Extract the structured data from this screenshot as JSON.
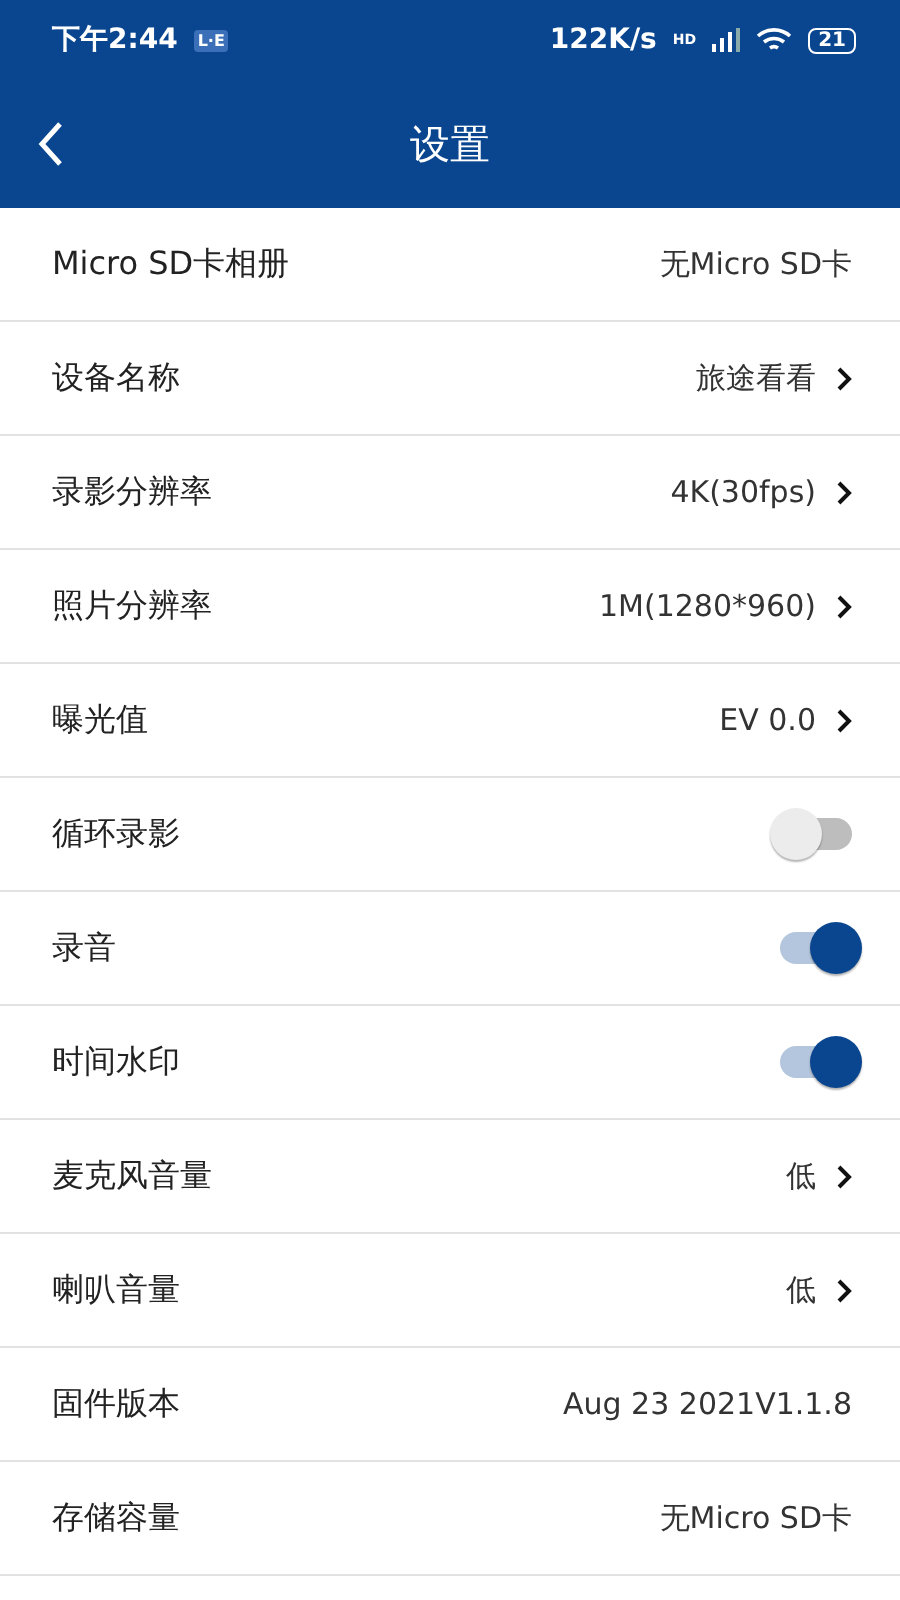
{
  "status_bar": {
    "time": "下午2:44",
    "badge": "L·E",
    "speed": "122K/s",
    "network": "HD",
    "battery": "21"
  },
  "header": {
    "title": "设置"
  },
  "rows": [
    {
      "kind": "value",
      "label": "Micro SD卡相册",
      "value": "无Micro SD卡"
    },
    {
      "kind": "link",
      "label": "设备名称",
      "value": "旅途看看"
    },
    {
      "kind": "link",
      "label": "录影分辨率",
      "value": "4K(30fps)"
    },
    {
      "kind": "link",
      "label": "照片分辨率",
      "value": "1M(1280*960)"
    },
    {
      "kind": "link",
      "label": "曝光值",
      "value": "EV 0.0"
    },
    {
      "kind": "toggle",
      "label": "循环录影",
      "on": false
    },
    {
      "kind": "toggle",
      "label": "录音",
      "on": true
    },
    {
      "kind": "toggle",
      "label": "时间水印",
      "on": true
    },
    {
      "kind": "link",
      "label": "麦克风音量",
      "value": "低"
    },
    {
      "kind": "link",
      "label": "喇叭音量",
      "value": "低"
    },
    {
      "kind": "value",
      "label": "固件版本",
      "value": "Aug 23 2021V1.1.8"
    },
    {
      "kind": "value",
      "label": "存储容量",
      "value": "无Micro SD卡"
    }
  ]
}
